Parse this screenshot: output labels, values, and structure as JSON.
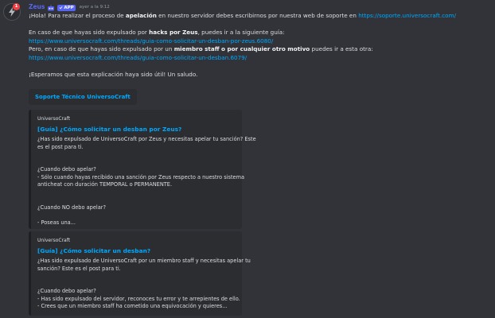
{
  "message": {
    "author": "Zeus",
    "app_tag": "APP",
    "timestamp": "ayer a la 9:12",
    "notification_count": "1",
    "lines": [
      {
        "parts": [
          {
            "t": "¡Hola! Para realizar el proceso de "
          },
          {
            "t": "apelación",
            "b": true
          },
          {
            "t": " en nuestro servidor debes escribirnos por nuestra web de soporte en "
          },
          {
            "t": "https://soporte.universocraft.com/",
            "link": true
          }
        ]
      },
      {
        "gap": true
      },
      {
        "parts": [
          {
            "t": "En caso de que hayas sido expulsado por "
          },
          {
            "t": "hacks por Zeus",
            "b": true
          },
          {
            "t": ", puedes ir a la siguiente guía:"
          }
        ]
      },
      {
        "parts": [
          {
            "t": "https://www.universocraft.com/threads/guia-como-solicitar-un-desban-por-zeus.6080/",
            "link": true
          }
        ]
      },
      {
        "parts": [
          {
            "t": "Pero, en caso de que hayas sido expulsado por un "
          },
          {
            "t": "miembro staff o por cualquier otro motivo",
            "b": true
          },
          {
            "t": " puedes ir a esta otra:"
          }
        ]
      },
      {
        "parts": [
          {
            "t": "https://www.universocraft.com/threads/guia-como-solicitar-un-desban.6079/",
            "link": true
          }
        ]
      },
      {
        "gap": true
      },
      {
        "parts": [
          {
            "t": "¡Esperamos que esta explicación haya sido útil! Un saludo."
          }
        ]
      }
    ],
    "button_label": "Soporte Técnico UniversoCraft"
  },
  "embeds": [
    {
      "author": "UniversoCraft",
      "title": "[Guía] ¿Cómo solicitar un desban por Zeus?",
      "lines": [
        "¿Has sido expulsado de UniversoCraft por Zeus y necesitas apelar tu sanción? Este",
        "es el post para ti.",
        "",
        "",
        "¿Cuando debo apelar?",
        "- Sólo cuando hayas recibido una sanción por Zeus respecto a nuestro sistema",
        "anticheat con duración TEMPORAL o PERMANENTE.",
        "",
        "",
        "¿Cuando NO debo apelar?",
        "",
        "- Poseas una..."
      ]
    },
    {
      "author": "UniversoCraft",
      "title": "[Guía] ¿Cómo solicitar un desban?",
      "lines": [
        "¿Has sido expulsado de UniversoCraft por un miembro staff y necesitas apelar tu",
        "sanción? Este es el post para ti.",
        "",
        "",
        "¿Cuando debo apelar?",
        "- Has sido expulsado del servidor, reconoces tu error y te arrepientes de ello.",
        "- Crees que un miembro staff ha cometido una equivocación y quieres..."
      ]
    }
  ],
  "colors": {
    "background": "#313338",
    "author": "#5865f2",
    "link": "#00a8fc",
    "embed_bg": "#2b2d31",
    "notification": "#f23f43"
  }
}
